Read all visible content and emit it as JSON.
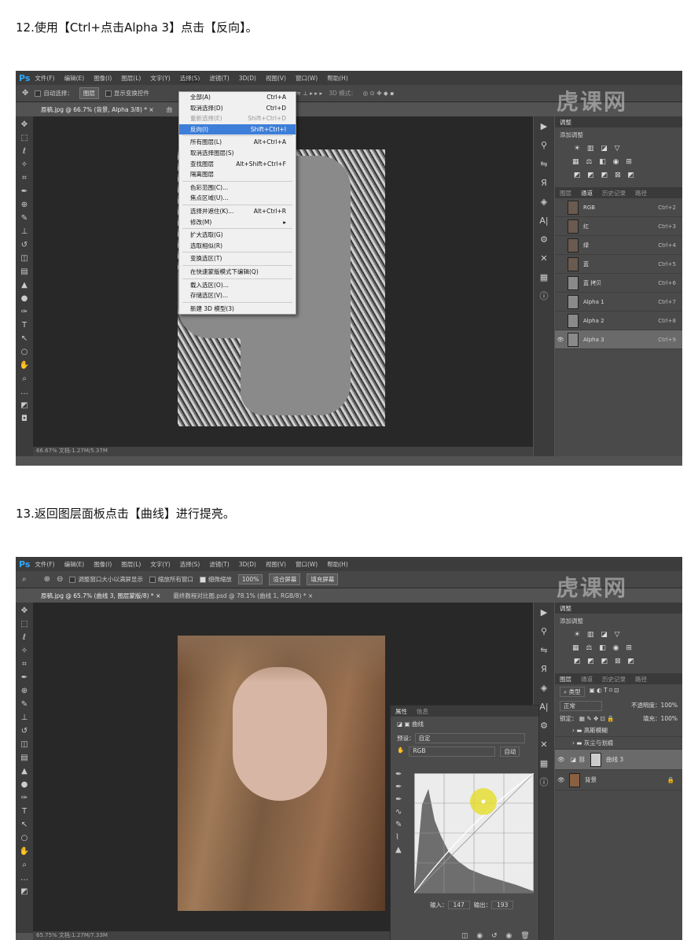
{
  "step12": "12.使用【Ctrl+点击Alpha 3】点击【反向】。",
  "step13": "13.返回图层面板点击【曲线】进行提亮。",
  "watermark": "虎课网",
  "ps1": {
    "logo": "Ps",
    "menus": [
      "文件(F)",
      "编辑(E)",
      "图像(I)",
      "图层(L)",
      "文字(Y)",
      "选择(S)",
      "滤镜(T)",
      "3D(D)",
      "视图(V)",
      "窗口(W)",
      "帮助(H)"
    ],
    "opt_autoselect": "自动选择：",
    "opt_layer": "图层",
    "opt_transform": "显示变换控件",
    "opt_3d": "3D 模式：",
    "tab": "原稿.jpg @ 66.7% (背景, Alpha 3/8) *",
    "tab2": "曲",
    "status": "66.67%     文档:1.27M/5.37M",
    "select_menu": [
      {
        "label": "全部(A)",
        "sc": "Ctrl+A",
        "state": ""
      },
      {
        "label": "取消选择(D)",
        "sc": "Ctrl+D",
        "state": ""
      },
      {
        "label": "重新选择(E)",
        "sc": "Shift+Ctrl+D",
        "state": "dis"
      },
      {
        "label": "反向(I)",
        "sc": "Shift+Ctrl+I",
        "state": "hl"
      },
      {
        "sep": true
      },
      {
        "label": "所有图层(L)",
        "sc": "Alt+Ctrl+A",
        "state": ""
      },
      {
        "label": "取消选择图层(S)",
        "sc": "",
        "state": ""
      },
      {
        "label": "查找图层",
        "sc": "Alt+Shift+Ctrl+F",
        "state": ""
      },
      {
        "label": "隔离图层",
        "sc": "",
        "state": ""
      },
      {
        "sep": true
      },
      {
        "label": "色彩范围(C)...",
        "sc": "",
        "state": ""
      },
      {
        "label": "焦点区域(U)...",
        "sc": "",
        "state": ""
      },
      {
        "sep": true
      },
      {
        "label": "选择并遮住(K)...",
        "sc": "Alt+Ctrl+R",
        "state": ""
      },
      {
        "label": "修改(M)",
        "sc": "▸",
        "state": ""
      },
      {
        "sep": true
      },
      {
        "label": "扩大选取(G)",
        "sc": "",
        "state": ""
      },
      {
        "label": "选取相似(R)",
        "sc": "",
        "state": ""
      },
      {
        "sep": true
      },
      {
        "label": "变换选区(T)",
        "sc": "",
        "state": ""
      },
      {
        "sep": true
      },
      {
        "label": "在快速蒙版模式下编辑(Q)",
        "sc": "",
        "state": ""
      },
      {
        "sep": true
      },
      {
        "label": "载入选区(O)...",
        "sc": "",
        "state": ""
      },
      {
        "label": "存储选区(V)...",
        "sc": "",
        "state": ""
      },
      {
        "sep": true
      },
      {
        "label": "新建 3D 模型(3)",
        "sc": "",
        "state": ""
      }
    ],
    "adj_tab": "调整",
    "adj_add": "添加调整",
    "channel_tabs": [
      "图层",
      "通道",
      "历史记录",
      "路径"
    ],
    "channels": [
      {
        "name": "RGB",
        "sc": "Ctrl+2"
      },
      {
        "name": "红",
        "sc": "Ctrl+3"
      },
      {
        "name": "绿",
        "sc": "Ctrl+4"
      },
      {
        "name": "蓝",
        "sc": "Ctrl+5"
      },
      {
        "name": "蓝 拷贝",
        "sc": "Ctrl+6"
      },
      {
        "name": "Alpha 1",
        "sc": "Ctrl+7"
      },
      {
        "name": "Alpha 2",
        "sc": "Ctrl+8"
      },
      {
        "name": "Alpha 3",
        "sc": "Ctrl+9"
      }
    ]
  },
  "ps2": {
    "logo": "Ps",
    "menus": [
      "文件(F)",
      "编辑(E)",
      "图像(I)",
      "图层(L)",
      "文字(Y)",
      "选择(S)",
      "滤镜(T)",
      "3D(D)",
      "视图(V)",
      "窗口(W)",
      "帮助(H)"
    ],
    "opt_resize": "调整窗口大小以满屏显示",
    "opt_zoomall": "缩放所有窗口",
    "opt_scrubby": "细微缩放",
    "opt_zoom": "100%",
    "opt_fit": "适合屏幕",
    "opt_fill": "填充屏幕",
    "tab1": "原稿.jpg @ 65.7% (曲线 3, 图层蒙版/8) *",
    "tab2": "最终教程对比图.psd @ 78.1% (曲线 1, RGB/8) *",
    "status": "65.75%     文档:1.27M/7.33M",
    "props_tabs": [
      "属性",
      "信息"
    ],
    "props_title": "曲线",
    "preset_label": "预设：",
    "preset_value": "自定",
    "channel_value": "RGB",
    "auto_btn": "自动",
    "input_label": "输入：",
    "input_value": "147",
    "output_label": "输出：",
    "output_value": "193",
    "adj_tab": "调整",
    "adj_add": "添加调整",
    "layer_tabs": [
      "图层",
      "通道",
      "历史记录",
      "路径"
    ],
    "kind": "类型",
    "blend": "正常",
    "opacity_label": "不透明度：",
    "opacity": "100%",
    "lock_label": "锁定：",
    "fill_label": "填充：",
    "fill": "100%",
    "layers": [
      "高斯模糊",
      "灰尘与划痕",
      "曲线 3",
      "背景"
    ]
  }
}
